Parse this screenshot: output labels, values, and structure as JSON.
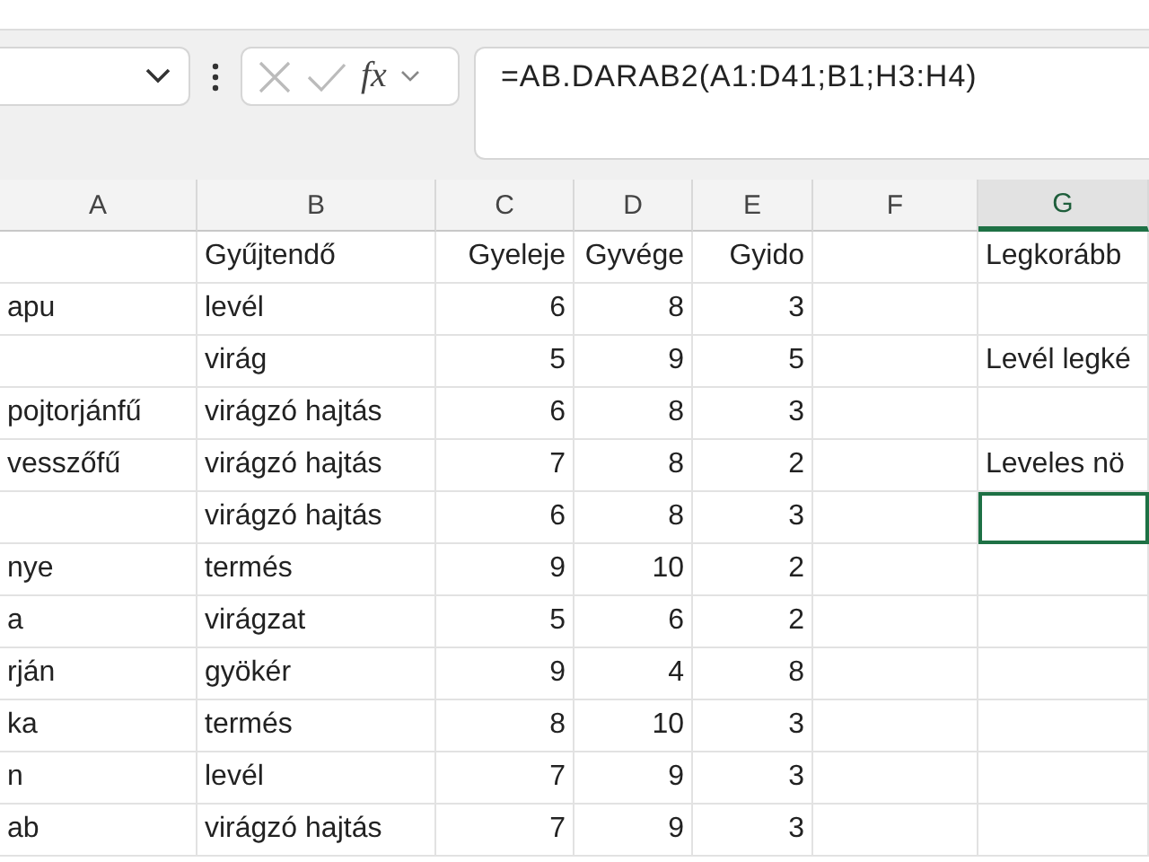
{
  "formula_bar": {
    "function_label": "fx",
    "formula": "=AB.DARAB2(A1:D41;B1;H3:H4)"
  },
  "columns": [
    {
      "label": "A",
      "selected": false
    },
    {
      "label": "B",
      "selected": false
    },
    {
      "label": "C",
      "selected": false
    },
    {
      "label": "D",
      "selected": false
    },
    {
      "label": "E",
      "selected": false
    },
    {
      "label": "F",
      "selected": false
    },
    {
      "label": "G",
      "selected": true
    }
  ],
  "rows": [
    {
      "selected": false,
      "cells": {
        "B": "Gyűjtendő",
        "C": "Gyeleje",
        "D": "Gyvége",
        "E": "Gyido",
        "G": "Legkorább"
      }
    },
    {
      "selected": false,
      "cells": {
        "A": "apu",
        "B": "levél",
        "C": "6",
        "D": "8",
        "E": "3"
      }
    },
    {
      "selected": false,
      "cells": {
        "B": "virág",
        "C": "5",
        "D": "9",
        "E": "5",
        "G": "Levél legké"
      }
    },
    {
      "selected": false,
      "cells": {
        "A": "pojtorjánfű",
        "B": "virágzó hajtás",
        "C": "6",
        "D": "8",
        "E": "3"
      }
    },
    {
      "selected": false,
      "cells": {
        "A": "vesszőfű",
        "B": "virágzó hajtás",
        "C": "7",
        "D": "8",
        "E": "2",
        "G": "Leveles nö"
      }
    },
    {
      "selected": true,
      "cells": {
        "B": "virágzó hajtás",
        "C": "6",
        "D": "8",
        "E": "3"
      }
    },
    {
      "selected": false,
      "cells": {
        "A": "nye",
        "B": "termés",
        "C": "9",
        "D": "10",
        "E": "2"
      }
    },
    {
      "selected": false,
      "cells": {
        "A": "a",
        "B": "virágzat",
        "C": "5",
        "D": "6",
        "E": "2"
      }
    },
    {
      "selected": false,
      "cells": {
        "A": "rján",
        "B": "gyökér",
        "C": "9",
        "D": "4",
        "E": "8"
      }
    },
    {
      "selected": false,
      "cells": {
        "A": "ka",
        "B": "termés",
        "C": "8",
        "D": "10",
        "E": "3"
      }
    },
    {
      "selected": false,
      "cells": {
        "A": "n",
        "B": "levél",
        "C": "7",
        "D": "9",
        "E": "3"
      }
    },
    {
      "selected": false,
      "cells": {
        "A": "ab",
        "B": "virágzó hajtás",
        "C": "7",
        "D": "9",
        "E": "3"
      }
    }
  ]
}
